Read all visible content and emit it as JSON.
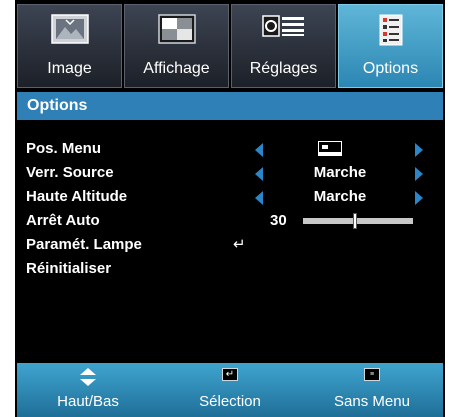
{
  "tabs": [
    {
      "label": "Image",
      "icon": "picture-icon",
      "active": false
    },
    {
      "label": "Affichage",
      "icon": "display-icon",
      "active": false
    },
    {
      "label": "Réglages",
      "icon": "settings-icon",
      "active": false
    },
    {
      "label": "Options",
      "icon": "options-icon",
      "active": true
    }
  ],
  "header": {
    "title": "Options"
  },
  "menu": {
    "pos_menu": {
      "label": "Pos. Menu",
      "value_icon": "menu-position-icon"
    },
    "verr_source": {
      "label": "Verr. Source",
      "value": "Marche"
    },
    "haute_altitude": {
      "label": "Haute Altitude",
      "value": "Marche"
    },
    "arret_auto": {
      "label": "Arrêt Auto",
      "value": "30",
      "slider_fraction": 0.47
    },
    "param_lampe": {
      "label": "Paramét. Lampe",
      "value_icon": "enter-icon"
    },
    "reinitialiser": {
      "label": "Réinitialiser"
    }
  },
  "footer": {
    "nav": {
      "label": "Haut/Bas",
      "icon": "up-down-arrow-icon"
    },
    "select": {
      "label": "Sélection",
      "icon": "enter-key-icon"
    },
    "menu": {
      "label": "Sans Menu",
      "icon": "menu-key-icon"
    }
  },
  "colors": {
    "active_tab": "#2b86b2",
    "header_bar": "#2e80b6",
    "arrows": "#2a86c8",
    "footer": "#1f6f98",
    "background": "#000000"
  }
}
